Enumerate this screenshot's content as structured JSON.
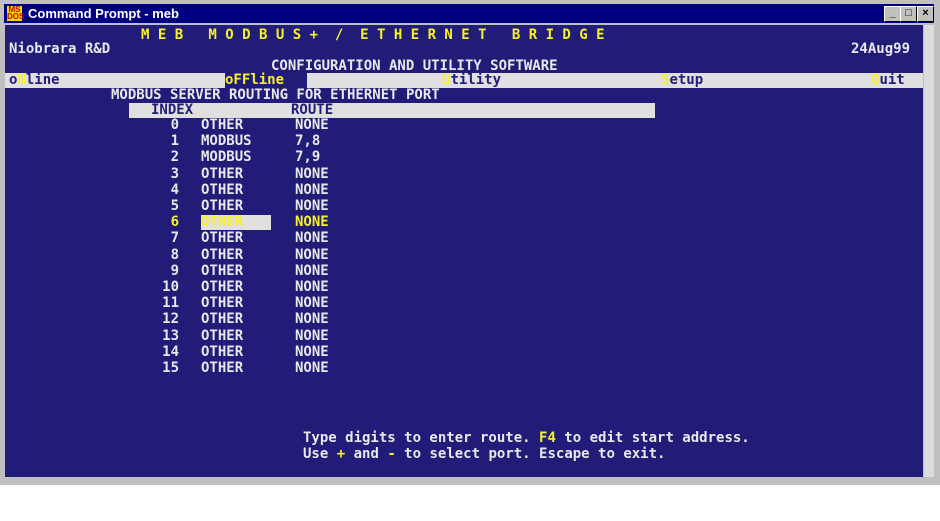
{
  "window": {
    "title": "Command Prompt - meb",
    "icon_text": "MS\nDOS",
    "minimize_glyph": "_",
    "maximize_glyph": "□",
    "close_glyph": "×"
  },
  "header": {
    "product_title": "M E B   M O D B U S +  /  E T H E R N E T   B R I D G E",
    "company": "Niobrara R&D",
    "date": "24Aug99",
    "subtitle": "CONFIGURATION AND UTILITY SOFTWARE"
  },
  "menu": {
    "online": {
      "prefix": "o",
      "hotkey": "N",
      "rest": "line"
    },
    "offline": {
      "label": "oFFline"
    },
    "utility": {
      "hotkey": "U",
      "rest": "tility"
    },
    "setup": {
      "hotkey": "S",
      "rest": "etup"
    },
    "quit": {
      "hotkey": "Q",
      "rest": "uit"
    }
  },
  "screen": {
    "heading": "MODBUS SERVER ROUTING FOR ETHERNET PORT",
    "col_index": "INDEX",
    "col_route": "ROUTE"
  },
  "rows": [
    {
      "index": "0",
      "type": "OTHER",
      "route": "NONE"
    },
    {
      "index": "1",
      "type": "MODBUS",
      "route": "7,8"
    },
    {
      "index": "2",
      "type": "MODBUS",
      "route": "7,9"
    },
    {
      "index": "3",
      "type": "OTHER",
      "route": "NONE"
    },
    {
      "index": "4",
      "type": "OTHER",
      "route": "NONE"
    },
    {
      "index": "5",
      "type": "OTHER",
      "route": "NONE"
    },
    {
      "index": "6",
      "type": "OTHER",
      "route": "NONE"
    },
    {
      "index": "7",
      "type": "OTHER",
      "route": "NONE"
    },
    {
      "index": "8",
      "type": "OTHER",
      "route": "NONE"
    },
    {
      "index": "9",
      "type": "OTHER",
      "route": "NONE"
    },
    {
      "index": "10",
      "type": "OTHER",
      "route": "NONE"
    },
    {
      "index": "11",
      "type": "OTHER",
      "route": "NONE"
    },
    {
      "index": "12",
      "type": "OTHER",
      "route": "NONE"
    },
    {
      "index": "13",
      "type": "OTHER",
      "route": "NONE"
    },
    {
      "index": "14",
      "type": "OTHER",
      "route": "NONE"
    },
    {
      "index": "15",
      "type": "OTHER",
      "route": "NONE"
    }
  ],
  "selected_index": 6,
  "help": {
    "line1_a": "Type digits to enter route. ",
    "line1_key": "F4",
    "line1_b": " to edit start address.",
    "line2_a": "Use ",
    "line2_plus": "+",
    "line2_b": " and ",
    "line2_minus": "-",
    "line2_c": " to select port. Escape to exit."
  },
  "colors": {
    "console_bg": "#201c78",
    "text": "#e8e8e8",
    "highlight": "#f8f028",
    "bar": "#e0e0e0",
    "titlebar": "#000080"
  }
}
